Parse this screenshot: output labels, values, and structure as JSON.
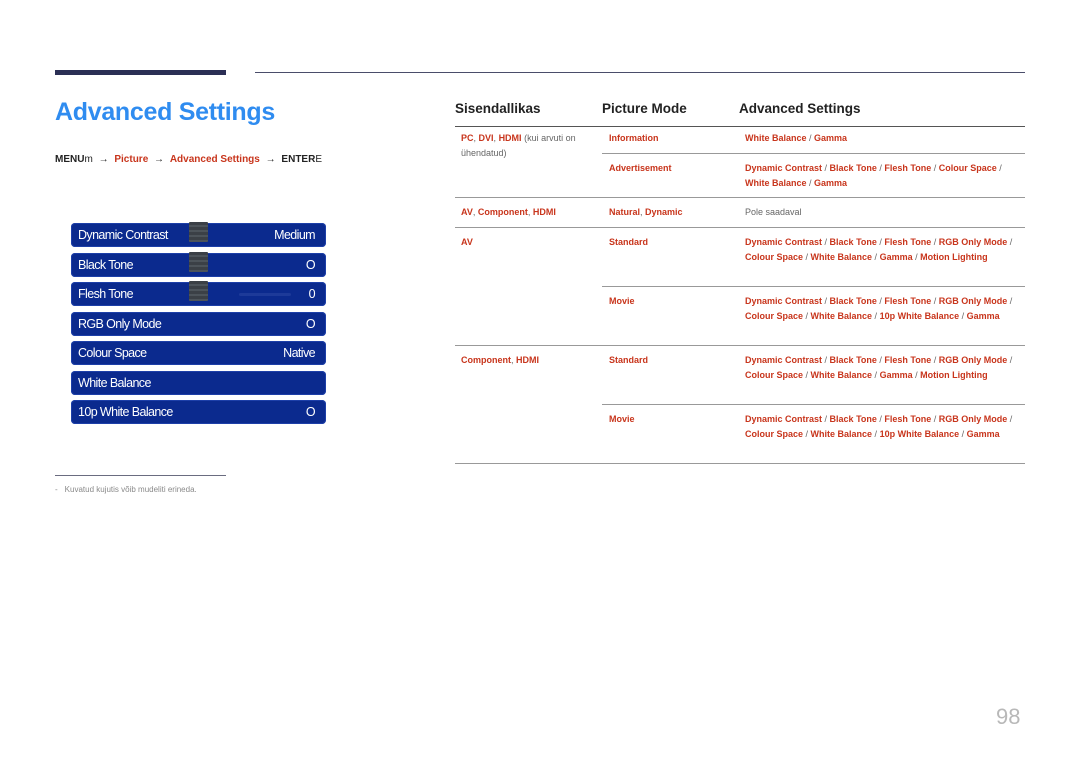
{
  "page": {
    "title": "Advanced Settings",
    "page_number": "98",
    "breadcrumb": {
      "menu": "MENU",
      "menu_icon": "m",
      "arrow": "→",
      "picture": "Picture",
      "advanced": "Advanced Settings",
      "enter": "ENTER",
      "enter_icon": "E"
    },
    "footnote": {
      "dash": "-",
      "text": "Kuvatud kujutis võib mudeliti erineda."
    }
  },
  "osd": {
    "items": [
      {
        "label": "Dynamic Contrast",
        "value": "Medium",
        "slider": true
      },
      {
        "label": "Black Tone",
        "value": "O",
        "slider": true
      },
      {
        "label": "Flesh Tone",
        "value": "0",
        "slider": true,
        "track": true
      },
      {
        "label": "RGB Only Mode",
        "value": "O"
      },
      {
        "label": "Colour Space",
        "value": "Native"
      },
      {
        "label": "White Balance",
        "value": ""
      },
      {
        "label": "10p White Balance",
        "value": "O"
      }
    ]
  },
  "table": {
    "headers": [
      "Sisendallikas",
      "Picture Mode",
      "Advanced Settings"
    ],
    "rows": [
      {
        "source": [
          "PC",
          "DVI",
          "HDMI"
        ],
        "source_note": "(kui arvuti on ühendatud)",
        "mode": "Information",
        "settings": [
          "White Balance",
          "Gamma"
        ]
      },
      {
        "mode": "Advertisement",
        "settings": [
          "Dynamic Contrast",
          "Black Tone",
          "Flesh Tone",
          "Colour Space",
          "White Balance",
          "Gamma"
        ]
      },
      {
        "source": [
          "AV",
          "Component",
          "HDMI"
        ],
        "mode_parts": [
          "Natural",
          "Dynamic"
        ],
        "settings_plain": "Pole saadaval"
      },
      {
        "source": [
          "AV"
        ],
        "mode": "Standard",
        "settings": [
          "Dynamic Contrast",
          "Black Tone",
          "Flesh Tone",
          "RGB Only Mode",
          "Colour Space",
          "White Balance",
          "Gamma",
          "Motion Lighting"
        ]
      },
      {
        "mode": "Movie",
        "settings": [
          "Dynamic Contrast",
          "Black Tone",
          "Flesh Tone",
          "RGB Only Mode",
          "Colour Space",
          "White Balance",
          "10p White Balance",
          "Gamma"
        ]
      },
      {
        "source": [
          "Component",
          "HDMI"
        ],
        "mode": "Standard",
        "settings": [
          "Dynamic Contrast",
          "Black Tone",
          "Flesh Tone",
          "RGB Only Mode",
          "Colour Space",
          "White Balance",
          "Gamma",
          "Motion Lighting"
        ]
      },
      {
        "mode": "Movie",
        "settings": [
          "Dynamic Contrast",
          "Black Tone",
          "Flesh Tone",
          "RGB Only Mode",
          "Colour Space",
          "White Balance",
          "10p White Balance",
          "Gamma"
        ]
      }
    ]
  },
  "colors": {
    "title_blue": "#2f8cf0",
    "accent_red": "#c8351c",
    "osd_blue": "#0b2a8e",
    "header_bar": "#2b2f55"
  }
}
